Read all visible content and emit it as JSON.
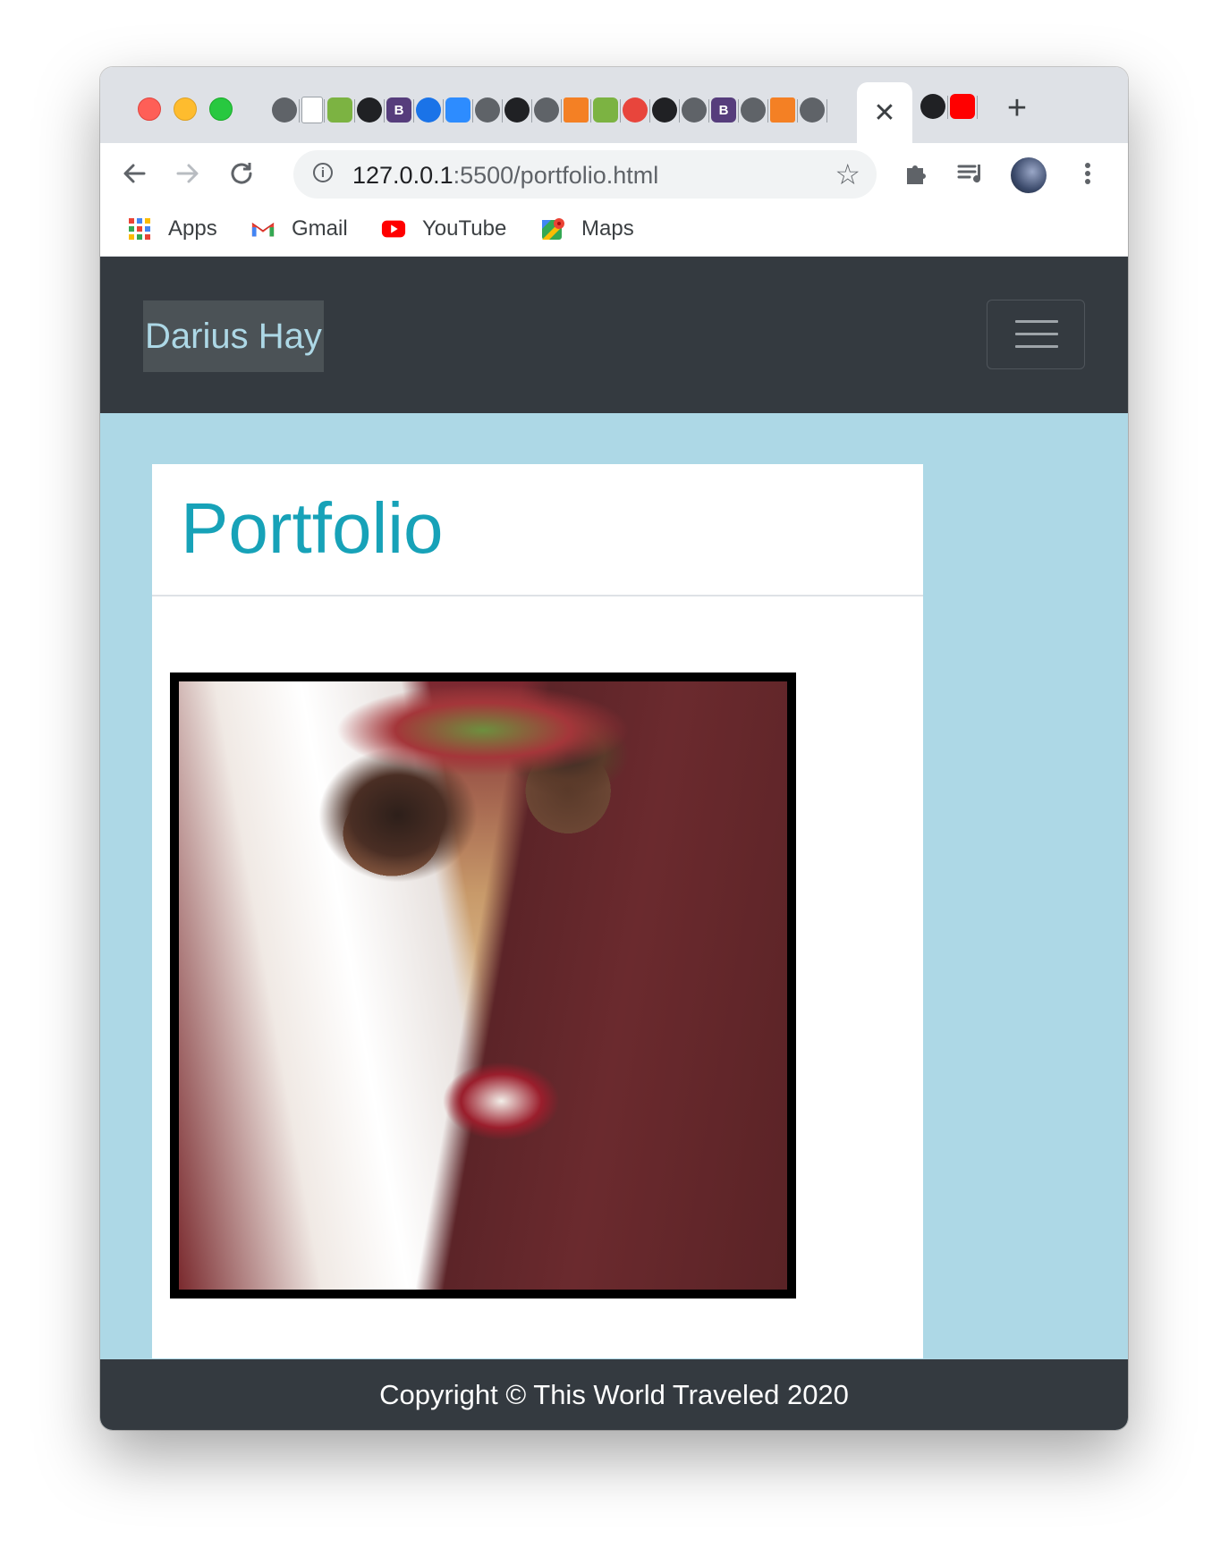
{
  "browser": {
    "tab_icons": [
      "globe-icon",
      "doc-icon",
      "green-icon",
      "github-icon",
      "bootstrap-icon",
      "sync-icon",
      "zoom-icon",
      "globe-icon",
      "github-icon",
      "globe-icon",
      "stackoverflow-icon",
      "green-icon",
      "asterisk-icon",
      "github-icon",
      "globe-icon",
      "bootstrap-icon",
      "globe-icon",
      "stackoverflow-icon",
      "globe-icon"
    ],
    "active_tab_close": "✕",
    "after_tabs": [
      "github-icon",
      "youtube-icon"
    ],
    "new_tab": "+",
    "url_host": "127.0.0.1",
    "url_rest": ":5500/portfolio.html",
    "bookmarks": [
      {
        "label": "Apps",
        "icon": "apps-grid-icon"
      },
      {
        "label": "Gmail",
        "icon": "gmail-icon"
      },
      {
        "label": "YouTube",
        "icon": "youtube-icon"
      },
      {
        "label": "Maps",
        "icon": "maps-icon"
      }
    ]
  },
  "page": {
    "brand": "Darius Hay",
    "title": "Portfolio",
    "photo_alt": "wedding photo",
    "footer": "Copyright © This World Traveled 2020"
  },
  "colors": {
    "navbar": "#343a40",
    "page_bg": "#add8e6",
    "title": "#17a2b8",
    "brand": "#add8e6"
  }
}
